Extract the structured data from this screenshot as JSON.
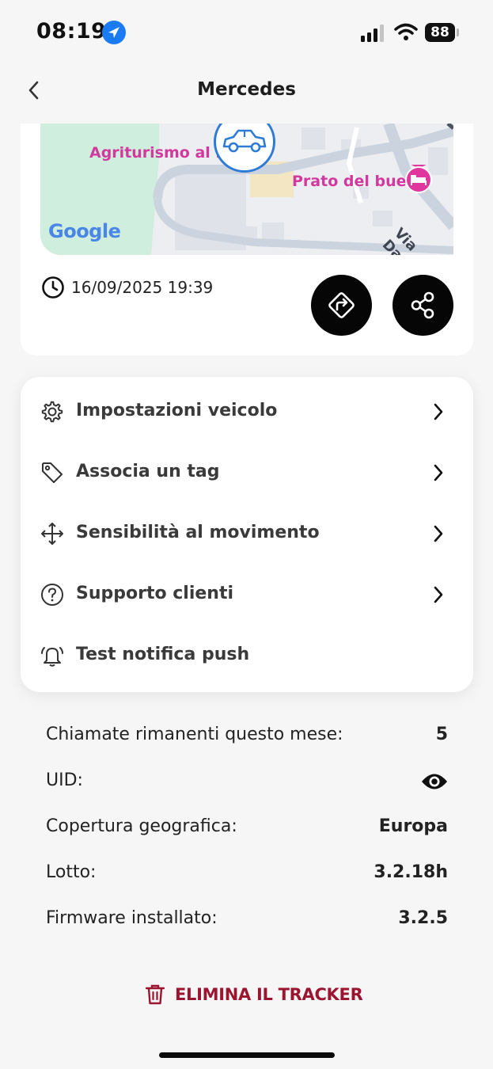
{
  "status_bar": {
    "time": "08:19",
    "battery": "88"
  },
  "header": {
    "title": "Mercedes",
    "back_icon": "chevron-left-icon"
  },
  "map": {
    "labels": [
      "Agriturismo al Pa",
      "Prato del bue",
      "Via Da"
    ],
    "attribution": "Google",
    "vehicle_icon": "car-icon",
    "poi_icon": "bed-icon",
    "colors": {
      "poi": "#e0379f",
      "vehicle_ring": "#2e7bd6",
      "park": "#cfeedd"
    }
  },
  "timestamp": "16/09/2025 19:39",
  "actions": [
    {
      "name": "directions-button",
      "icon": "directions-icon"
    },
    {
      "name": "share-button",
      "icon": "share-icon"
    }
  ],
  "menu": [
    {
      "label": "Impostazioni veicolo",
      "icon": "gear-icon",
      "chevron": true
    },
    {
      "label": "Associa un tag",
      "icon": "tag-icon",
      "chevron": true
    },
    {
      "label": "Sensibilità al movimento",
      "icon": "move-icon",
      "chevron": true
    },
    {
      "label": "Supporto clienti",
      "icon": "help-icon",
      "chevron": true
    },
    {
      "label": "Test notifica push",
      "icon": "bell-icon",
      "chevron": false
    }
  ],
  "info": [
    {
      "key": "Chiamate rimanenti questo mese:",
      "value": "5"
    },
    {
      "key": "UID:",
      "value": "",
      "icon": "eye-icon"
    },
    {
      "key": "Copertura geografica:",
      "value": "Europa"
    },
    {
      "key": "Lotto:",
      "value": "3.2.18h"
    },
    {
      "key": "Firmware installato:",
      "value": "3.2.5"
    }
  ],
  "delete": {
    "label": "ELIMINA IL TRACKER",
    "icon": "trash-icon",
    "color": "#9b1530"
  }
}
